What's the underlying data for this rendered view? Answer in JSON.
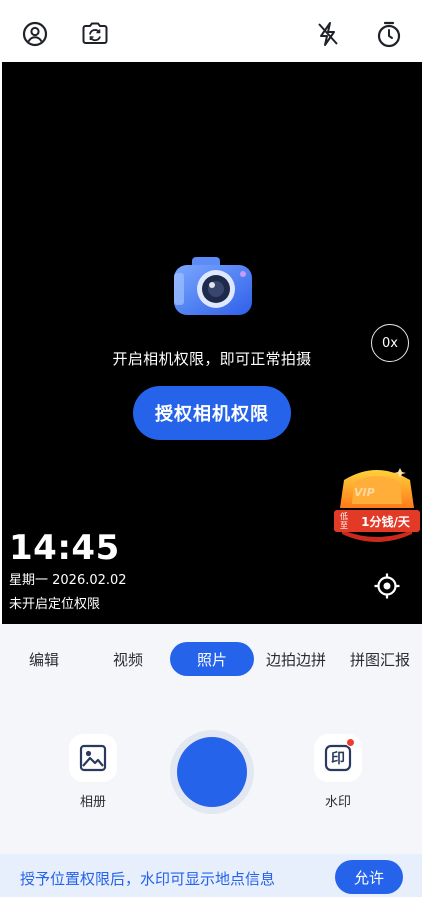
{
  "topbar": {
    "icons": [
      "profile-icon",
      "switch-camera-icon",
      "flash-off-icon",
      "timer-icon"
    ]
  },
  "viewfinder": {
    "permission_message": "开启相机权限，即可正常拍摄",
    "grant_button": "授权相机权限",
    "zoom_label": "0x",
    "vip": {
      "badge": "VIP",
      "low_top": "低",
      "low_bottom": "至",
      "price": "1分钱/天"
    },
    "watermark": {
      "time": "14:45",
      "date": "星期一 2026.02.02",
      "location_status": "未开启定位权限"
    }
  },
  "modes": [
    "编辑",
    "视频",
    "照片",
    "边拍边拼",
    "拼图汇报"
  ],
  "active_mode": "照片",
  "bottom": {
    "album_label": "相册",
    "watermark_label": "水印",
    "watermark_icon_text": "印"
  },
  "notice": {
    "text": "授予位置权限后，水印可显示地点信息",
    "allow_button": "允许"
  },
  "colors": {
    "accent": "#2563eb",
    "viewfinder_bg": "#000000",
    "panel_bg": "#f5f6f9",
    "notice_bg": "#e7eefc",
    "badge_red": "#e23a27"
  }
}
